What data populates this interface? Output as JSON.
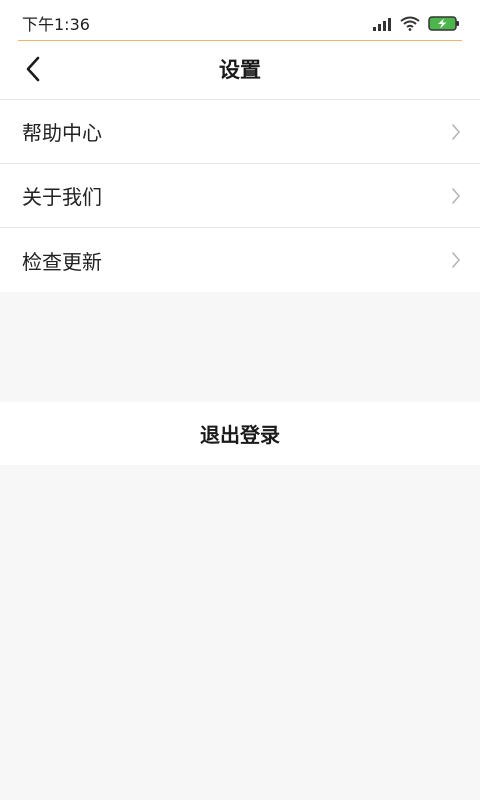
{
  "status_bar": {
    "time": "下午1:36",
    "icons": [
      "signal-icon",
      "wifi-icon",
      "battery-charging-icon"
    ],
    "battery_color": "#4cb64c",
    "accent_line_color": "#e7b96a"
  },
  "nav": {
    "title": "设置",
    "back_icon": "chevron-left-icon"
  },
  "menu": {
    "items": [
      {
        "label": "帮助中心",
        "icon": "chevron-right-icon"
      },
      {
        "label": "关于我们",
        "icon": "chevron-right-icon"
      },
      {
        "label": "检查更新",
        "icon": "chevron-right-icon"
      }
    ]
  },
  "logout": {
    "label": "退出登录"
  }
}
